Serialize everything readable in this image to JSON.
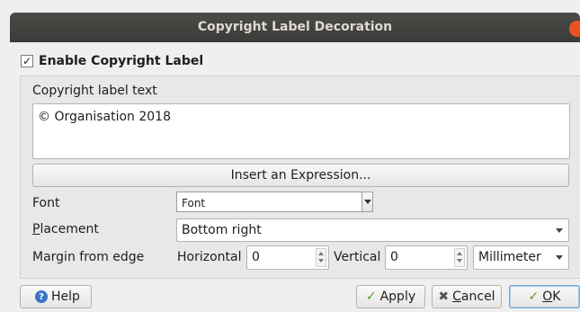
{
  "window": {
    "title": "Copyright Label Decoration"
  },
  "enable": {
    "label": "Enable Copyright Label",
    "checked": true,
    "check_glyph": "✓"
  },
  "label_text": {
    "caption": "Copyright label text",
    "value": "© Organisation 2018"
  },
  "expression_button": {
    "label": "Insert an Expression..."
  },
  "font": {
    "label": "Font",
    "button_value": "Font"
  },
  "placement": {
    "label_prefix": "P",
    "label_rest": "lacement",
    "value": "Bottom right"
  },
  "margin": {
    "label": "Margin from edge",
    "horizontal_label": "Horizontal",
    "horizontal_value": "0",
    "vertical_label": "Vertical",
    "vertical_value": "0",
    "unit_value": "Millimeter"
  },
  "footer": {
    "help_label": "Help",
    "apply_label": "Apply",
    "cancel_prefix": "C",
    "cancel_rest": "ancel",
    "ok_prefix": "O",
    "ok_rest": "K"
  },
  "icons": {
    "help": "help-icon",
    "apply": "check-icon",
    "cancel": "x-icon",
    "ok": "check-icon",
    "close": "close-icon"
  },
  "colors": {
    "titlebar": "#3f3f3d",
    "close": "#e9541f",
    "help_icon": "#3a74c6",
    "check_icon": "#5a9c2b"
  }
}
